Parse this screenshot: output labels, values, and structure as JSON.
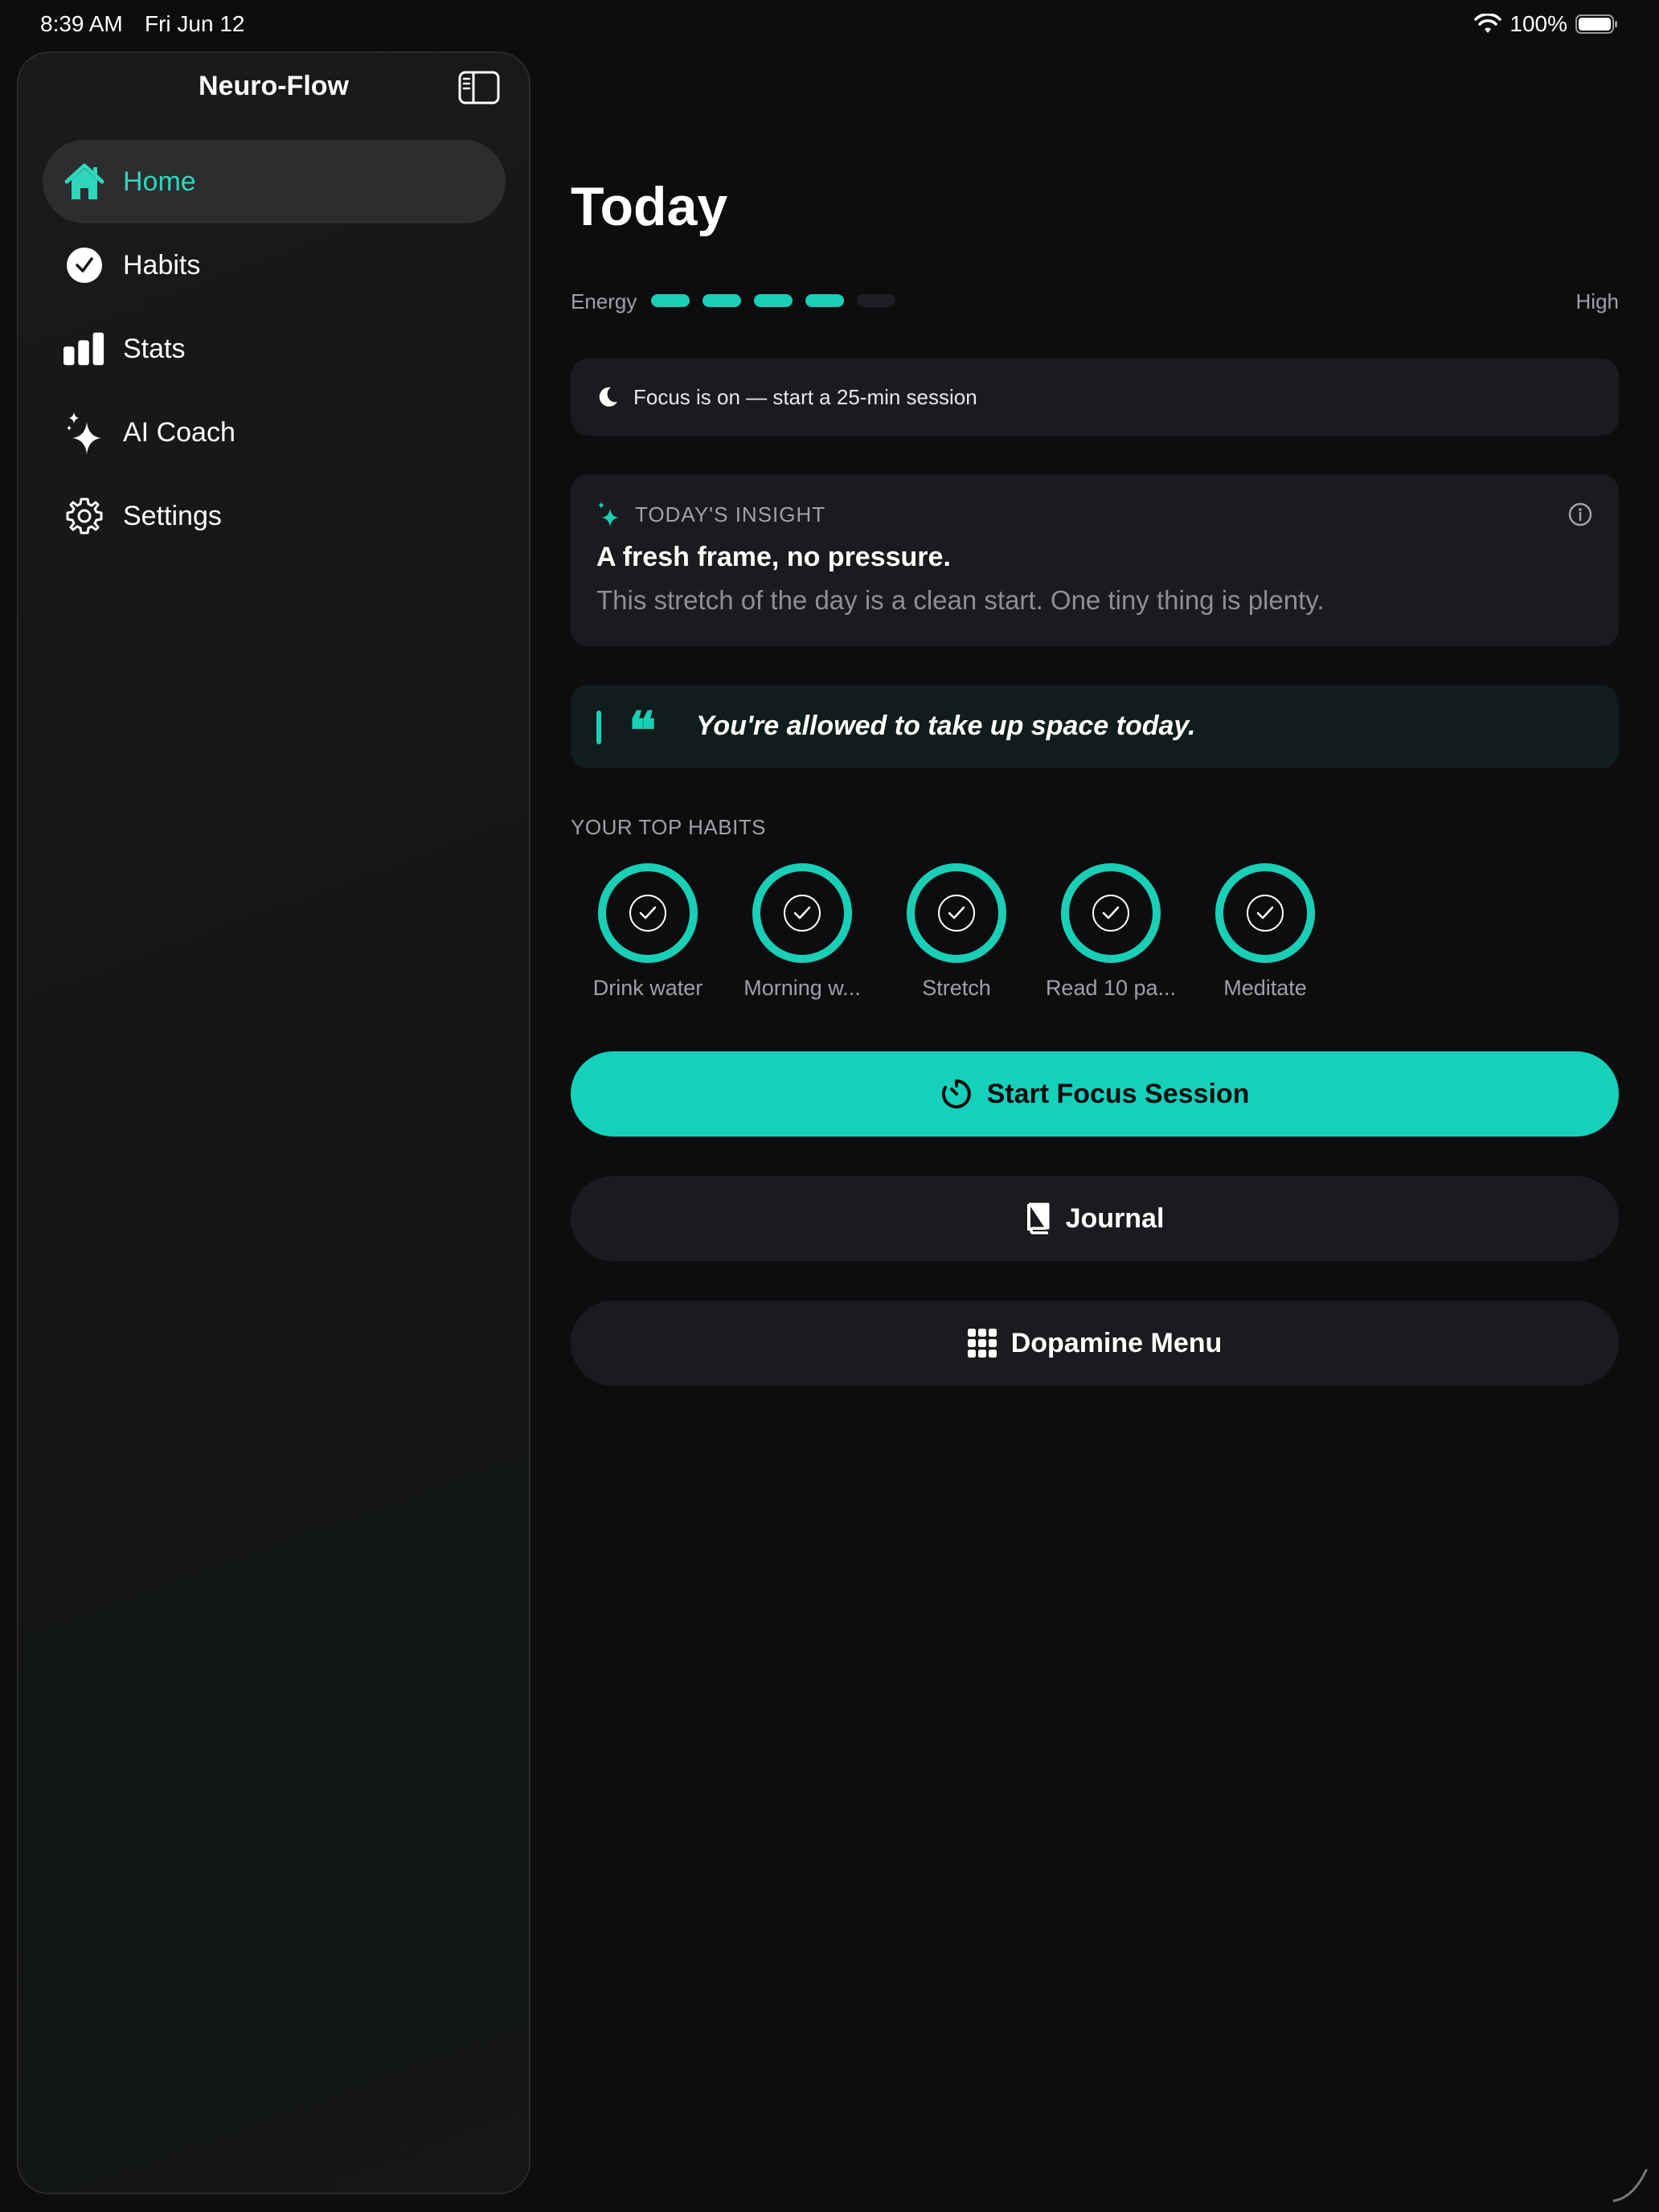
{
  "status_bar": {
    "time": "8:39 AM",
    "date": "Fri Jun 12",
    "battery": "100%"
  },
  "sidebar": {
    "title": "Neuro-Flow",
    "items": [
      {
        "label": "Home",
        "icon": "home-icon",
        "active": true
      },
      {
        "label": "Habits",
        "icon": "checkmark-circle-icon",
        "active": false
      },
      {
        "label": "Stats",
        "icon": "bar-chart-icon",
        "active": false
      },
      {
        "label": "AI Coach",
        "icon": "sparkles-icon",
        "active": false
      },
      {
        "label": "Settings",
        "icon": "gear-icon",
        "active": false
      }
    ]
  },
  "main": {
    "title": "Today",
    "energy": {
      "label": "Energy",
      "level": 4,
      "max": 5,
      "value": "High"
    },
    "focus_banner": {
      "text": "Focus is on — start a 25-min session",
      "icon": "moon-icon"
    },
    "insight": {
      "label": "TODAY'S INSIGHT",
      "title": "A fresh frame, no pressure.",
      "body": "This stretch of the day is a clean start. One tiny thing is plenty."
    },
    "quote": {
      "mark": "❝",
      "text": "You're allowed to take up space today."
    },
    "habits": {
      "label": "YOUR TOP HABITS",
      "items": [
        {
          "name": "Drink water"
        },
        {
          "name": "Morning w..."
        },
        {
          "name": "Stretch"
        },
        {
          "name": "Read 10 pa..."
        },
        {
          "name": "Meditate"
        }
      ]
    },
    "buttons": {
      "start_focus": "Start Focus Session",
      "journal": "Journal",
      "dopamine": "Dopamine Menu"
    }
  },
  "colors": {
    "accent": "#16d1ba",
    "background": "#0d0d10",
    "card": "#1b1b1f"
  }
}
